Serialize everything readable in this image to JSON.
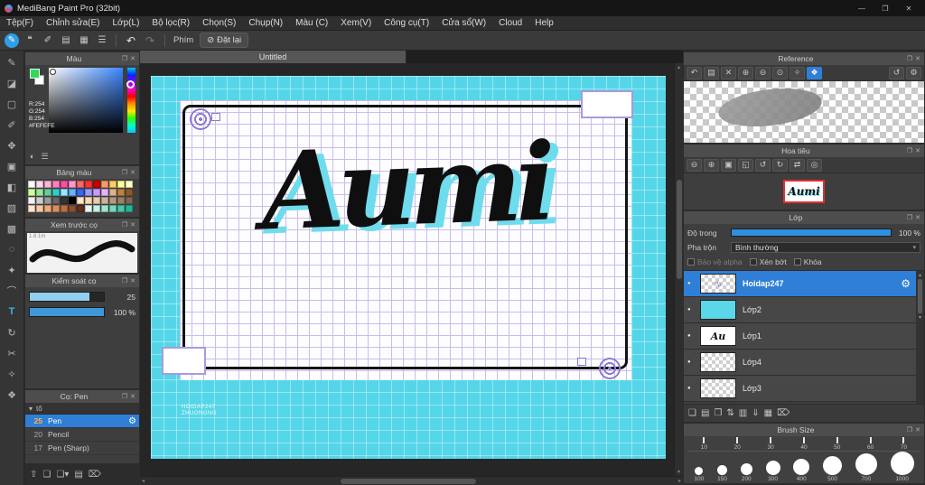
{
  "window": {
    "title": "MediBang Paint Pro (32bit)"
  },
  "icons": {
    "minimize": "—",
    "maximize": "❐",
    "close": "✕",
    "popout": "❐",
    "panel_close": "✕",
    "chevron_down": "▾",
    "gear": "⚙",
    "undo": "↶",
    "redo": "↷",
    "reset": "⊘",
    "eye_dot": "●",
    "scroll_up": "▴",
    "scroll_down": "▾",
    "scroll_left": "◂",
    "scroll_right": "▸",
    "color_wheel": "◐",
    "color_sliders": "☰"
  },
  "menu": {
    "items": [
      "Tệp(F)",
      "Chỉnh sửa(E)",
      "Lớp(L)",
      "Bộ lọc(R)",
      "Chọn(S)",
      "Chụp(N)",
      "Màu (C)",
      "Xem(V)",
      "Công cụ(T)",
      "Cửa sổ(W)",
      "Cloud",
      "Help"
    ]
  },
  "toolbar": {
    "phim_label": "Phím",
    "reset_label": "Đặt lại",
    "icons": [
      {
        "name": "brush-panel-icon",
        "glyph": "✎",
        "active": true
      },
      {
        "name": "comment-icon",
        "glyph": "❝"
      },
      {
        "name": "material-icon",
        "glyph": "✐"
      },
      {
        "name": "document-icon",
        "glyph": "▤"
      },
      {
        "name": "grid-icon",
        "glyph": "▦"
      },
      {
        "name": "list-icon",
        "glyph": "☰"
      }
    ]
  },
  "tools": [
    {
      "name": "pen-tool",
      "glyph": "✎"
    },
    {
      "name": "eraser-tool",
      "glyph": "◪"
    },
    {
      "name": "marquee-tool",
      "glyph": "▢"
    },
    {
      "name": "brush-tool",
      "glyph": "✐"
    },
    {
      "name": "move-tool",
      "glyph": "✥"
    },
    {
      "name": "transform-tool",
      "glyph": "▣"
    },
    {
      "name": "bucket-tool",
      "glyph": "◧"
    },
    {
      "name": "gradient-tool",
      "glyph": "▨"
    },
    {
      "name": "select-pen-tool",
      "glyph": "▩"
    },
    {
      "name": "lasso-tool",
      "glyph": "◌"
    },
    {
      "name": "magic-wand-tool",
      "glyph": "✦"
    },
    {
      "name": "curve-tool",
      "glyph": "⌒"
    },
    {
      "name": "text-tool",
      "glyph": "T",
      "active": true
    },
    {
      "name": "rotate-view-tool",
      "glyph": "↻"
    },
    {
      "name": "divide-tool",
      "glyph": "✂"
    },
    {
      "name": "eyedropper-tool",
      "glyph": "✧"
    },
    {
      "name": "hand-tool",
      "glyph": "❖"
    }
  ],
  "left_panels": {
    "color": {
      "title": "Màu",
      "r": "R:254",
      "g": "G:254",
      "b": "B:254",
      "hex": "#FEFEFE"
    },
    "palette": {
      "title": "Bảng màu",
      "colors": [
        "#ffffff",
        "#ffd9e8",
        "#ffb3d9",
        "#ff80bf",
        "#ff4da6",
        "#ff99cc",
        "#ff6666",
        "#ff3333",
        "#cc0000",
        "#ff9966",
        "#ffcc66",
        "#ffff99",
        "#ffffcc",
        "#ccff99",
        "#99e699",
        "#66cc99",
        "#33cccc",
        "#99e6ff",
        "#66b3ff",
        "#3366ff",
        "#9999ff",
        "#cc99ff",
        "#e6b3ff",
        "#d9b38c",
        "#bf8040",
        "#8c5929",
        "#f2f2f2",
        "#cccccc",
        "#999999",
        "#666666",
        "#333333",
        "#000000",
        "#ffe6cc",
        "#ffd9b3",
        "#e6ccb3",
        "#ccb399",
        "#b39980",
        "#99806a",
        "#806653",
        "#fbe3d6",
        "#f6c9a0",
        "#eda978",
        "#d98e5f",
        "#b96f45",
        "#8e4f2f",
        "#612f1a",
        "#e8f8f0",
        "#c6f0e0",
        "#9fe6cf",
        "#73d9bc",
        "#45c9a6",
        "#21b894"
      ]
    },
    "brush_preview": {
      "title": "Xem trước cọ",
      "note": "1.8.1m"
    },
    "brush_control": {
      "title": "Kiểm soát cọ",
      "size_value": "25",
      "opacity_value": "100 %"
    },
    "brush_list": {
      "title": "Cọ: Pen",
      "group": "tô",
      "brushes": [
        {
          "size": "25",
          "name": "Pen",
          "selected": true
        },
        {
          "size": "20",
          "name": "Pencil"
        },
        {
          "size": "17",
          "name": "Pen (Sharp)"
        }
      ]
    },
    "dock": [
      {
        "name": "dock-up-icon",
        "glyph": "⇧"
      },
      {
        "name": "new-brush-icon",
        "glyph": "❏"
      },
      {
        "name": "new-brush-menu-icon",
        "glyph": "❏▾"
      },
      {
        "name": "brush-folder-icon",
        "glyph": "▤"
      },
      {
        "name": "delete-brush-icon",
        "glyph": "⌦"
      }
    ]
  },
  "canvas": {
    "tab": "Untitled",
    "artwork_text": "Aumi",
    "watermark_line1": "HOIDAP247",
    "watermark_line2": "ZHUONGNG"
  },
  "right_panels": {
    "reference": {
      "title": "Reference",
      "toolbar": [
        {
          "name": "back-icon",
          "glyph": "↶"
        },
        {
          "name": "open-folder-icon",
          "glyph": "▤"
        },
        {
          "name": "clear-icon",
          "glyph": "✕"
        },
        {
          "name": "zoom-in-icon",
          "glyph": "⊕"
        },
        {
          "name": "zoom-out-icon",
          "glyph": "⊖"
        },
        {
          "name": "pin-icon",
          "glyph": "⊙"
        },
        {
          "name": "eyedropper-icon",
          "glyph": "✧"
        },
        {
          "name": "hand-icon",
          "glyph": "❖",
          "active": true
        },
        {
          "name": "rotate-left-icon",
          "glyph": "↺",
          "push": true
        },
        {
          "name": "settings-icon",
          "glyph": "⚙"
        }
      ]
    },
    "navigator": {
      "title": "Hoa tiêu",
      "thumb_text": "Aumi",
      "toolbar": [
        {
          "name": "zoom-out-icon",
          "glyph": "⊖"
        },
        {
          "name": "zoom-in-icon",
          "glyph": "⊕"
        },
        {
          "name": "fit-window-icon",
          "glyph": "▣"
        },
        {
          "name": "original-size-icon",
          "glyph": "◱"
        },
        {
          "name": "rotate-left-icon",
          "glyph": "↺"
        },
        {
          "name": "rotate-right-icon",
          "glyph": "↻"
        },
        {
          "name": "flip-icon",
          "glyph": "⇄"
        },
        {
          "name": "reset-view-icon",
          "glyph": "◎"
        }
      ]
    },
    "layers": {
      "title": "Lớp",
      "opacity_label": "Độ trong",
      "opacity_value": "100 %",
      "blend_label": "Pha trộn",
      "blend_value": "Bình thường",
      "checkboxes": [
        "Bảo vệ alpha",
        "Xén bớt",
        "Khóa"
      ],
      "items": [
        {
          "name": "Hoidap247",
          "selected": true,
          "thumb": "marks",
          "thumb_text": "∿"
        },
        {
          "name": "Lớp2",
          "thumb": "cyan",
          "thumb_text": ""
        },
        {
          "name": "Lớp1",
          "thumb": "script",
          "thumb_text": "Au"
        },
        {
          "name": "Lớp4",
          "thumb": "plain",
          "thumb_text": ""
        },
        {
          "name": "Lớp3",
          "thumb": "plain",
          "thumb_text": ""
        }
      ],
      "toolbar": [
        {
          "name": "new-layer-icon",
          "glyph": "❏"
        },
        {
          "name": "new-folder-icon",
          "glyph": "▤"
        },
        {
          "name": "duplicate-layer-icon",
          "glyph": "❐"
        },
        {
          "name": "transfer-layer-icon",
          "glyph": "⇅"
        },
        {
          "name": "layer-folder-icon",
          "glyph": "▥"
        },
        {
          "name": "merge-down-icon",
          "glyph": "⇓"
        },
        {
          "name": "flatten-icon",
          "glyph": "▦"
        },
        {
          "name": "delete-layer-icon",
          "glyph": "⌦"
        }
      ]
    },
    "brush_size": {
      "title": "Brush Size",
      "ticks": [
        "10",
        "20",
        "30",
        "40",
        "50",
        "60",
        "70"
      ],
      "sizes": [
        "100",
        "150",
        "200",
        "300",
        "400",
        "500",
        "700",
        "1000"
      ]
    }
  }
}
